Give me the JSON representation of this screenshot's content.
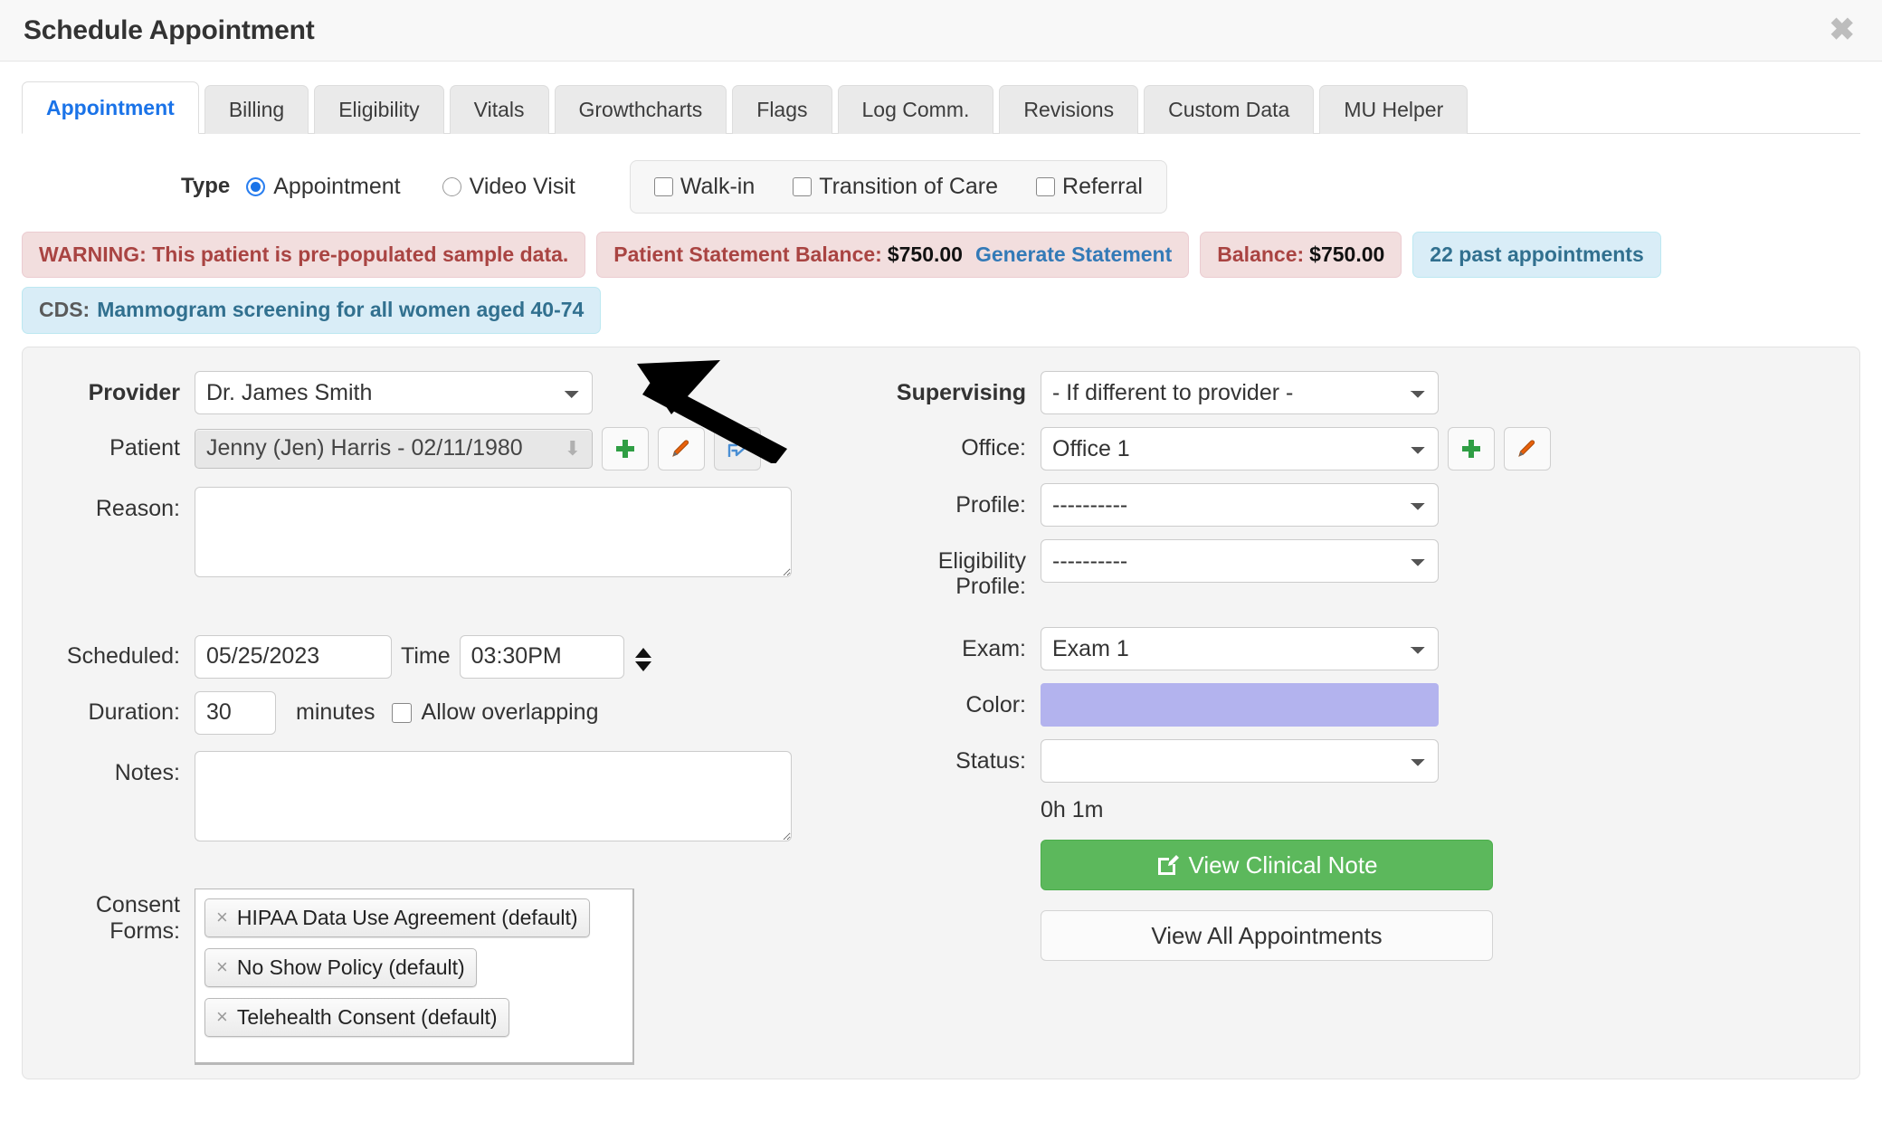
{
  "window": {
    "title": "Schedule Appointment",
    "close_label": "✖"
  },
  "tabs": [
    {
      "label": "Appointment",
      "active": true
    },
    {
      "label": "Billing",
      "active": false
    },
    {
      "label": "Eligibility",
      "active": false
    },
    {
      "label": "Vitals",
      "active": false
    },
    {
      "label": "Growthcharts",
      "active": false
    },
    {
      "label": "Flags",
      "active": false
    },
    {
      "label": "Log Comm.",
      "active": false
    },
    {
      "label": "Revisions",
      "active": false
    },
    {
      "label": "Custom Data",
      "active": false
    },
    {
      "label": "MU Helper",
      "active": false
    }
  ],
  "type_row": {
    "label": "Type",
    "radios": [
      {
        "label": "Appointment",
        "checked": true
      },
      {
        "label": "Video Visit",
        "checked": false
      }
    ],
    "checkboxes": [
      {
        "label": "Walk-in",
        "checked": false
      },
      {
        "label": "Transition of Care",
        "checked": false
      },
      {
        "label": "Referral",
        "checked": false
      }
    ]
  },
  "alerts": {
    "warning": "WARNING: This patient is pre-populated sample data.",
    "statement_label": "Patient Statement Balance:",
    "statement_amount": "$750.00",
    "generate_statement": "Generate Statement",
    "balance_label": "Balance:",
    "balance_amount": "$750.00",
    "past_appointments": "22 past appointments",
    "cds_key": "CDS:",
    "cds_text": "Mammogram screening for all women aged 40-74"
  },
  "left_form": {
    "provider_label": "Provider",
    "provider_value": "Dr. James Smith",
    "patient_label": "Patient",
    "patient_value": "Jenny (Jen) Harris - 02/11/1980",
    "reason_label": "Reason:",
    "reason_value": "",
    "scheduled_label": "Scheduled:",
    "scheduled_value": "05/25/2023",
    "time_label": "Time",
    "time_value": "03:30PM",
    "duration_label": "Duration:",
    "duration_value": "30",
    "minutes_label": "minutes",
    "allow_overlapping_label": "Allow overlapping",
    "allow_overlapping_checked": false,
    "notes_label": "Notes:",
    "notes_value": "",
    "consent_label": "Consent Forms:",
    "consent_forms": [
      "HIPAA Data Use Agreement (default)",
      "No Show Policy (default)",
      "Telehealth Consent (default)"
    ],
    "chip_remove": "×"
  },
  "right_form": {
    "supervising_label": "Supervising",
    "supervising_value": "- If different to provider -",
    "office_label": "Office:",
    "office_value": "Office 1",
    "profile_label": "Profile:",
    "profile_value": "----------",
    "eligibility_profile_label": "Eligibility Profile:",
    "eligibility_profile_value": "----------",
    "exam_label": "Exam:",
    "exam_value": "Exam 1",
    "color_label": "Color:",
    "color_value": "#b3b3ee",
    "status_label": "Status:",
    "status_value": "",
    "duration_text": "0h 1m",
    "view_clinical_note": "View Clinical Note",
    "view_all_appointments": "View All Appointments"
  },
  "colors": {
    "accent_blue": "#1a73e8",
    "alert_danger_bg": "#f2dede",
    "alert_danger_text": "#a94442",
    "alert_info_bg": "#d9edf7",
    "alert_info_text": "#31708f",
    "link_blue": "#337ab7",
    "green_button": "#5cb85c",
    "appointment_color_swatch": "#b3b3ee"
  }
}
